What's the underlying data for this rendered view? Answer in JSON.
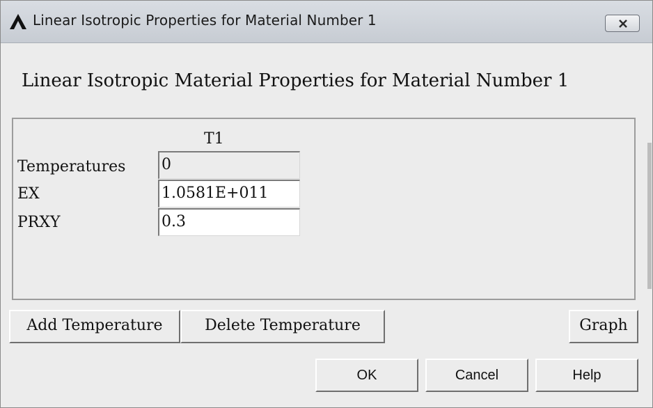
{
  "window": {
    "title": "Linear Isotropic Properties for Material Number 1",
    "logo_icon": "ansys-logo-icon",
    "close_icon": "close-icon"
  },
  "heading": "Linear Isotropic Material Properties for Material Number 1",
  "table": {
    "column_header": "T1",
    "rows": [
      {
        "label": "Temperatures",
        "value": "0",
        "editable": false
      },
      {
        "label": "EX",
        "value": "1.0581E+011",
        "editable": true
      },
      {
        "label": "PRXY",
        "value": "0.3",
        "editable": true
      }
    ]
  },
  "buttons": {
    "add_temperature": "Add Temperature",
    "delete_temperature": "Delete Temperature",
    "graph": "Graph",
    "ok": "OK",
    "cancel": "Cancel",
    "help": "Help"
  },
  "colors": {
    "dialog_bg": "#ececec",
    "titlebar": "#c7ccd3",
    "close_glyph": "#2b2b2b"
  }
}
